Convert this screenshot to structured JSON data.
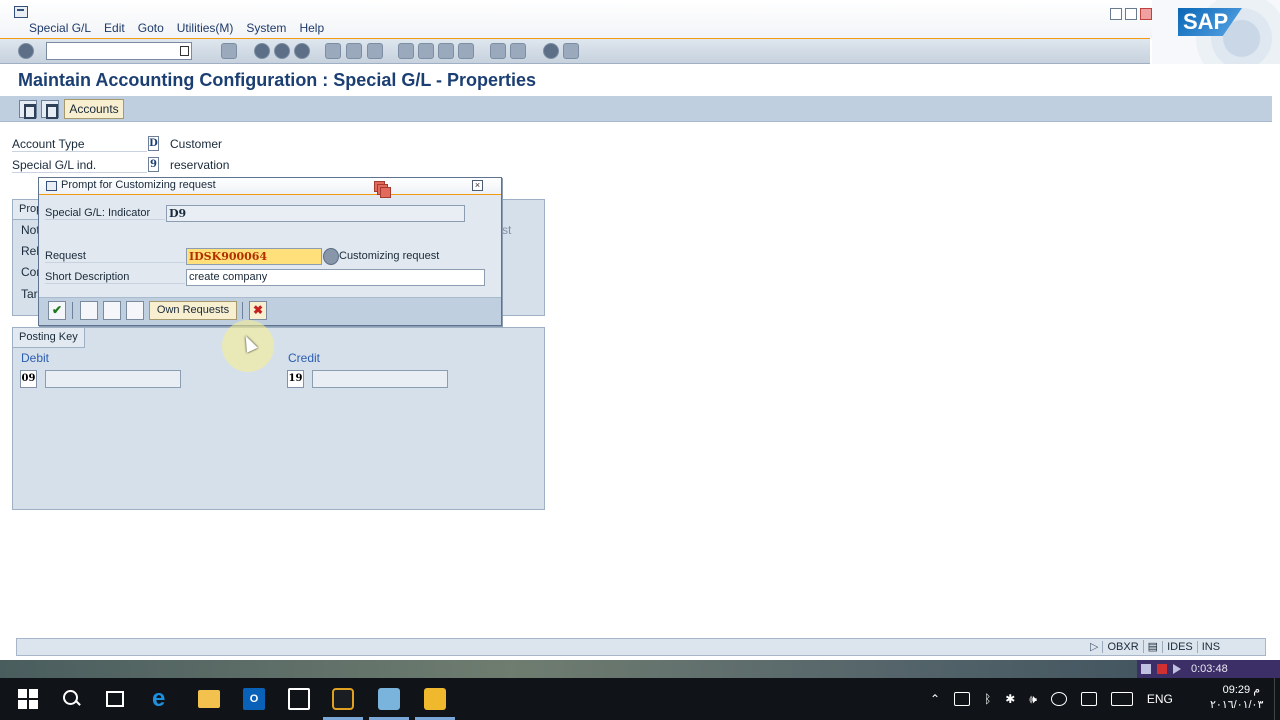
{
  "menu": {
    "items": [
      "Special G/L",
      "Edit",
      "Goto",
      "Utilities(M)",
      "System",
      "Help"
    ]
  },
  "brand": {
    "logo_text": "SAP"
  },
  "page": {
    "title": "Maintain Accounting Configuration : Special G/L - Properties",
    "accounts_button": "Accounts"
  },
  "header_fields": {
    "account_type_label": "Account Type",
    "account_type_value": "D",
    "account_type_text": "Customer",
    "special_gl_label": "Special G/L ind.",
    "special_gl_value": "9",
    "special_gl_text": "reservation"
  },
  "properties_group": {
    "tab_label": "Prop",
    "row_fragments": [
      "Not",
      "Rel",
      "Cor",
      "Tar"
    ],
    "right_fragment": "st"
  },
  "posting_key": {
    "tab_label": "Posting Key",
    "debit_label": "Debit",
    "debit_value": "09",
    "credit_label": "Credit",
    "credit_value": "19"
  },
  "popup": {
    "title": "Prompt for Customizing request",
    "indicator_label": "Special G/L: Indicator",
    "indicator_value": "D9",
    "request_label": "Request",
    "request_value": "IDSK900064",
    "request_hint": "Customizing request",
    "short_desc_label": "Short Description",
    "short_desc_value": "create company",
    "own_requests_button": "Own Requests"
  },
  "status_bar": {
    "transaction": "OBXR",
    "system": "IDES",
    "mode": "INS"
  },
  "recorder": {
    "elapsed": "0:03:48"
  },
  "taskbar": {
    "language": "ENG",
    "time": "09:29 م",
    "date": "٢٠١٦/٠١/٠٣"
  },
  "colors": {
    "title_blue": "#1c3f73",
    "toolbar_bg": "#bfcfe0",
    "group_bg": "#d6e0ea",
    "request_field_bg": "#ffe07a",
    "accent_orange": "#f39c12"
  }
}
